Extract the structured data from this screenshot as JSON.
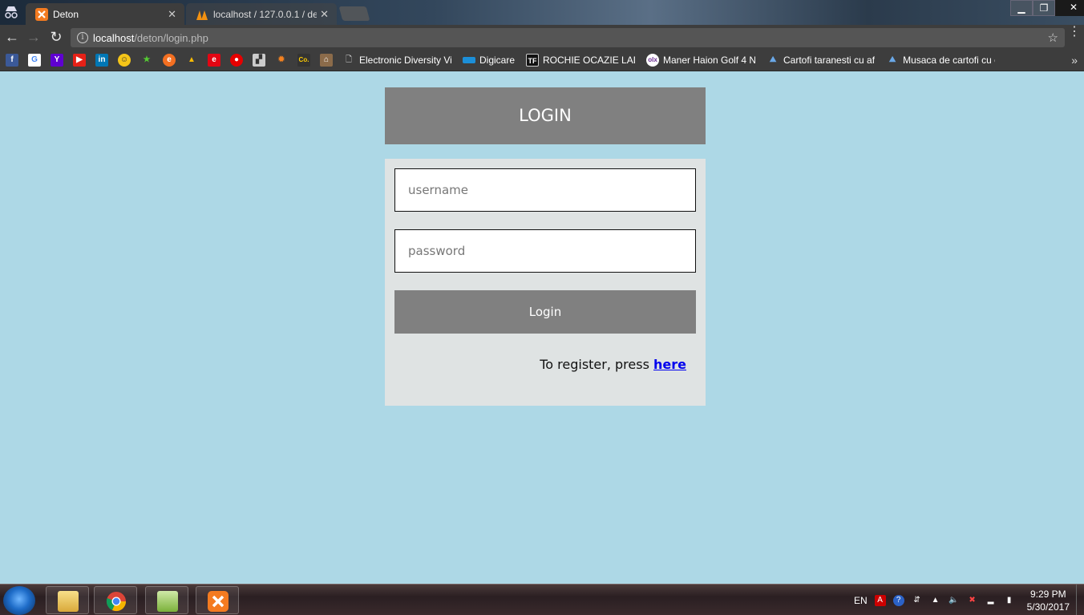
{
  "browser": {
    "tabs": [
      {
        "title": "Deton",
        "active": true
      },
      {
        "title": "localhost / 127.0.0.1 / de",
        "active": false
      }
    ],
    "url_host": "localhost",
    "url_path": "/deton/login.php",
    "bookmarks": [
      {
        "label": "Electronic Diversity Vi",
        "icon": "document-icon"
      },
      {
        "label": "Digicare",
        "icon": "digicare-icon"
      },
      {
        "label": "ROCHIE OCAZIE LADY",
        "icon": "tf-icon"
      },
      {
        "label": "Maner Haion Golf 4 N",
        "icon": "olx-icon"
      },
      {
        "label": "Cartofi taranesti cu af",
        "icon": "recipe-icon"
      },
      {
        "label": "Musaca de cartofi cu c",
        "icon": "recipe-icon"
      }
    ]
  },
  "login": {
    "header": "LOGIN",
    "username_placeholder": "username",
    "password_placeholder": "password",
    "button_label": "Login",
    "register_text": "To register, press ",
    "register_link": "here"
  },
  "taskbar": {
    "language": "EN",
    "time": "9:29 PM",
    "date": "5/30/2017"
  },
  "colors": {
    "page_bg": "#add8e6",
    "header_bg": "#808080",
    "box_bg": "#dfe3e3",
    "link": "#0000ee"
  }
}
